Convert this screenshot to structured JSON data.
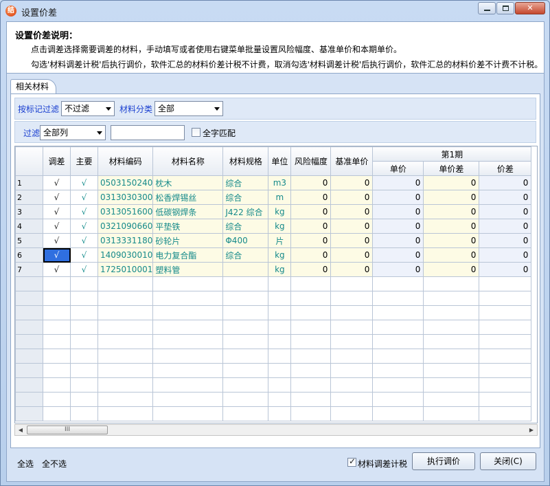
{
  "window": {
    "title": "设置价差",
    "app_icon_glyph": "结"
  },
  "description": {
    "title": "设置价差说明：",
    "line1": "点击调差选择需要调差的材料，手动填写或者使用右键菜单批量设置风险幅度、基准单价和本期单价。",
    "line2": "勾选'材料调差计税'后执行调价，软件汇总的材料价差计税不计费，取消勾选'材料调差计税'后执行调价，软件汇总的材料价差不计费不计税。"
  },
  "tab": {
    "label": "相关材料"
  },
  "filters": {
    "mark_filter_label": "按标记过滤",
    "mark_filter_value": "不过滤",
    "category_label": "材料分类",
    "category_value": "全部",
    "filter_label": "过滤",
    "column_value": "全部列",
    "search_value": "",
    "exact_match_label": "全字匹配",
    "exact_match_checked": false
  },
  "table": {
    "headers": {
      "adjust": "调差",
      "main": "主要",
      "code": "材料编码",
      "name": "材料名称",
      "spec": "材料规格",
      "unit": "单位",
      "risk": "风险幅度",
      "base_price": "基准单价",
      "period": "第1期",
      "unit_price": "单价",
      "unit_diff": "单价差",
      "diff": "价差"
    },
    "rows": [
      {
        "no": "1",
        "adjust": "√",
        "main": "√",
        "code": "0503150240",
        "name": "枕木",
        "spec": "综合",
        "unit": "m3",
        "risk": "0",
        "base": "0",
        "price": "0",
        "udiff": "0",
        "diff": "0"
      },
      {
        "no": "2",
        "adjust": "√",
        "main": "√",
        "code": "0313030300",
        "name": "松香焊锡丝",
        "spec": "综合",
        "unit": "m",
        "risk": "0",
        "base": "0",
        "price": "0",
        "udiff": "0",
        "diff": "0"
      },
      {
        "no": "3",
        "adjust": "√",
        "main": "√",
        "code": "0313051600",
        "name": "低碳钢焊条",
        "spec": "J422 综合",
        "unit": "kg",
        "risk": "0",
        "base": "0",
        "price": "0",
        "udiff": "0",
        "diff": "0"
      },
      {
        "no": "4",
        "adjust": "√",
        "main": "√",
        "code": "0321090660",
        "name": "平垫铁",
        "spec": "综合",
        "unit": "kg",
        "risk": "0",
        "base": "0",
        "price": "0",
        "udiff": "0",
        "diff": "0"
      },
      {
        "no": "5",
        "adjust": "√",
        "main": "√",
        "code": "0313331180",
        "name": "砂轮片",
        "spec": "Φ400",
        "unit": "片",
        "risk": "0",
        "base": "0",
        "price": "0",
        "udiff": "0",
        "diff": "0"
      },
      {
        "no": "6",
        "adjust": "√",
        "main": "√",
        "code": "1409030010",
        "name": "电力复合酯",
        "spec": "综合",
        "unit": "kg",
        "risk": "0",
        "base": "0",
        "price": "0",
        "udiff": "0",
        "diff": "0"
      },
      {
        "no": "7",
        "adjust": "√",
        "main": "√",
        "code": "1725010001",
        "name": "塑料管",
        "spec": "",
        "unit": "kg",
        "risk": "0",
        "base": "0",
        "price": "0",
        "udiff": "0",
        "diff": "0"
      }
    ],
    "selected_row": 6
  },
  "scroll": {
    "thumb_glyph": "III"
  },
  "footer": {
    "select_all": "全选",
    "select_none": "全不选",
    "tax_label": "材料调差计税",
    "tax_checked": true,
    "execute_label": "执行调价",
    "close_label": "关闭(C)"
  }
}
